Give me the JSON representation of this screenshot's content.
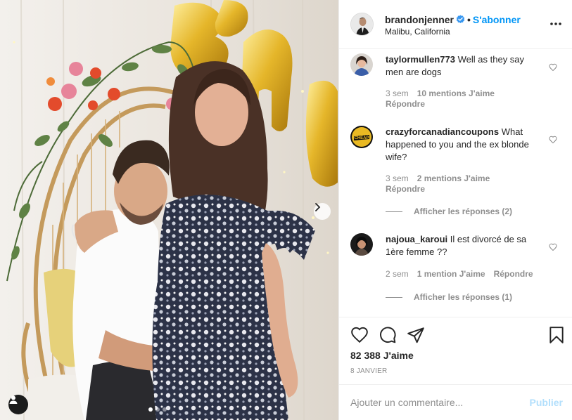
{
  "post": {
    "colors": {
      "accent": "#0095f6",
      "accent_disabled": "#b2dffc",
      "muted": "#8e8e8e",
      "text": "#262626"
    },
    "photo": {
      "icons": {
        "next": "chevron-right-icon",
        "tags": "user-tag-icon"
      },
      "carousel": {
        "count": 3,
        "active": 1
      }
    },
    "header": {
      "username": "brandonjenner",
      "separator": "•",
      "follow_label": "S'abonner",
      "location": "Malibu, California",
      "more_icon": "more-options-icon"
    },
    "comments": [
      {
        "username": "taylormullen773",
        "text": "Well as they say men are dogs",
        "time": "3 sem",
        "likes": "10 mentions J'aime",
        "reply": "Répondre"
      },
      {
        "username": "crazyforcanadiancoupons",
        "text": "What happened to you and the ex blonde wife?",
        "time": "3 sem",
        "likes": "2 mentions J'aime",
        "reply": "Répondre",
        "view_replies": "Afficher les réponses (2)"
      },
      {
        "username": "najoua_karoui",
        "text": "Il est divorcé de sa 1ère femme ??",
        "time": "2 sem",
        "likes": "1 mention J'aime",
        "reply": "Répondre",
        "view_replies": "Afficher les réponses (1)"
      }
    ],
    "actions": {
      "icons": [
        "heart-icon",
        "comment-icon",
        "share-icon",
        "bookmark-icon"
      ],
      "likes": "82 388 J'aime",
      "date": "8 JANVIER"
    },
    "comment_box": {
      "placeholder": "Ajouter un commentaire...",
      "publish_label": "Publier"
    }
  }
}
